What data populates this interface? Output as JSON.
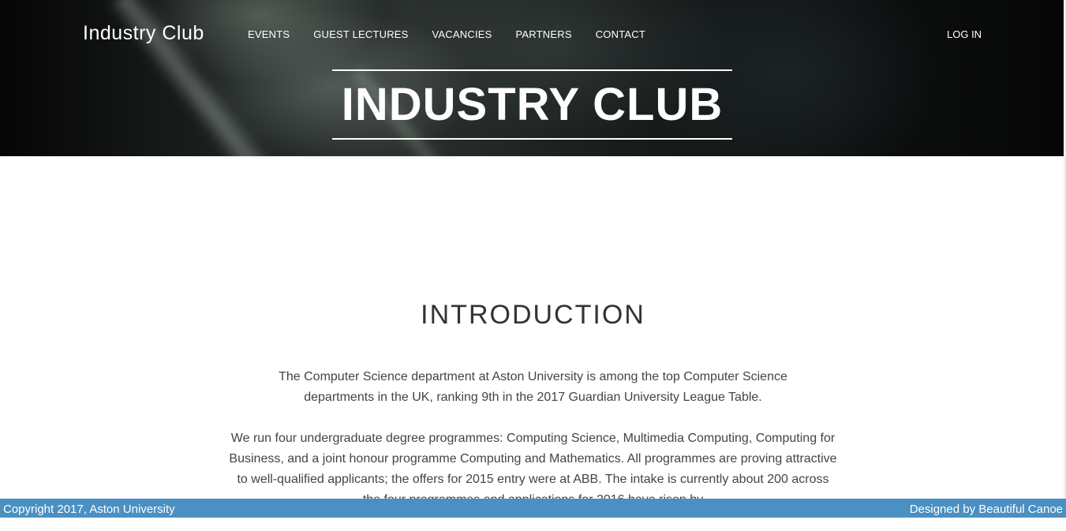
{
  "header": {
    "brand": "Industry Club",
    "nav": [
      "EVENTS",
      "GUEST LECTURES",
      "VACANCIES",
      "PARTNERS",
      "CONTACT"
    ],
    "login": "LOG IN",
    "hero_title": "INDUSTRY CLUB"
  },
  "main": {
    "section_title": "INTRODUCTION",
    "paragraphs": [
      "The Computer Science department at Aston University is among the top Computer Science departments in the UK, ranking 9th in the 2017 Guardian University League Table.",
      "We run four undergraduate degree programmes: Computing Science, Multimedia Computing, Computing for Business, and a joint honour programme Computing and Mathematics. All programmes are proving attractive to well-qualified applicants; the offers for 2015 entry were at ABB. The intake is currently about 200 across the four programmes and applications for 2016 have risen by"
    ]
  },
  "footer": {
    "copyright": "Copyright 2017, Aston University",
    "credit": "Designed by Beautiful Canoe"
  },
  "colors": {
    "footer_bg": "#4a90c2",
    "hero_text": "#ffffff",
    "body_text": "#444444"
  }
}
